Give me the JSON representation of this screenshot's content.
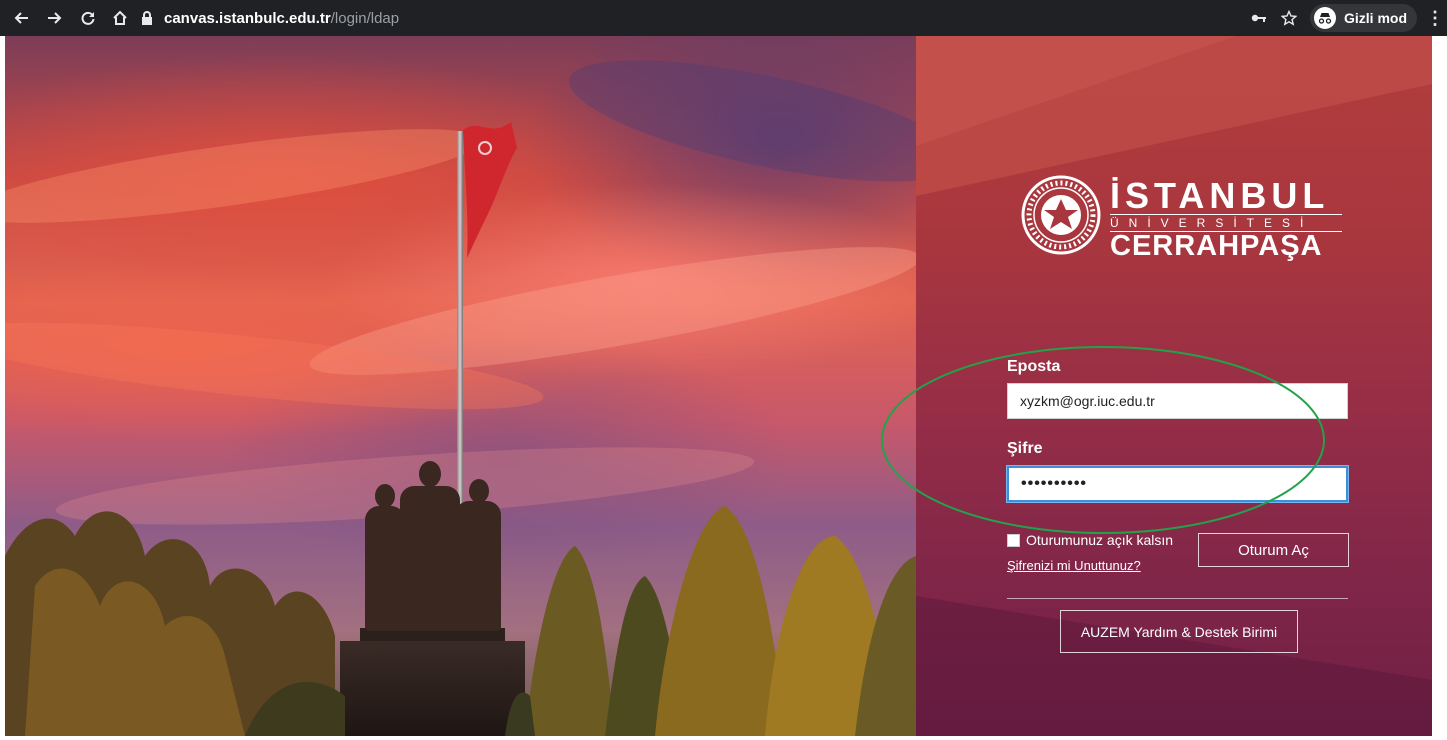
{
  "browser": {
    "url_host": "canvas.istanbulc.edu.tr",
    "url_path": "/login/ldap",
    "profile_label": "Gizli mod",
    "icons": [
      "back-arrow-icon",
      "forward-arrow-icon",
      "reload-icon",
      "home-icon",
      "lock-icon",
      "key-icon",
      "star-icon",
      "incognito-icon",
      "menu-dots-icon"
    ]
  },
  "logo": {
    "title": "İSTANBUL",
    "subtitle": "ÜNİVERSİTESİ",
    "name": "CERRAHPAŞA"
  },
  "form": {
    "email_label": "Eposta",
    "email_value": "xyzkm@ogr.iuc.edu.tr",
    "password_label": "Şifre",
    "password_value": "••••••••••",
    "remember_label": "Oturumunuz açık kalsın",
    "remember_checked": false,
    "forgot_label": "Şifrenizi mi Unuttunuz?",
    "login_button": "Oturum Aç",
    "help_button": "AUZEM Yardım & Destek Birimi"
  },
  "colors": {
    "panel_top": "#b23e3c",
    "panel_bottom": "#6f1f44",
    "highlight_ellipse": "#22a34a",
    "chrome_bar": "#202124"
  }
}
